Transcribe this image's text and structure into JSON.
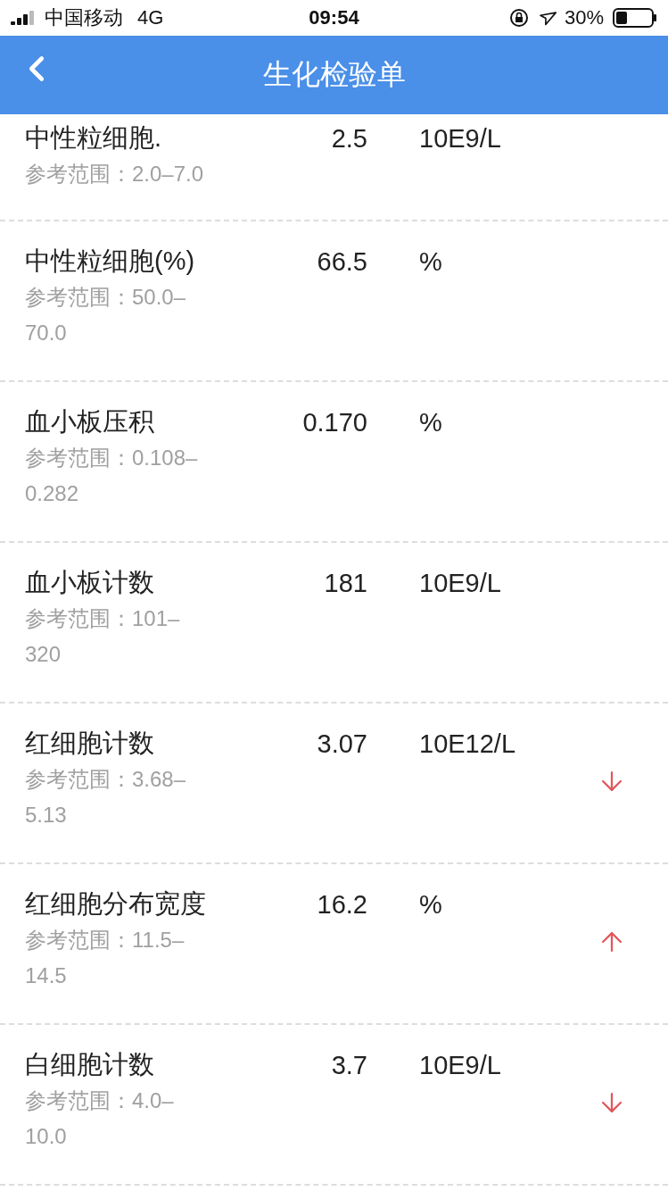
{
  "status_bar": {
    "carrier": "中国移动",
    "network": "4G",
    "time": "09:54",
    "battery": "30%"
  },
  "nav": {
    "title": "生化检验单"
  },
  "rows": [
    {
      "name": "中性粒细胞.",
      "value": "2.5",
      "unit": "10E9/L",
      "reference": "参考范围：2.0–7.0",
      "low": false,
      "high": false
    },
    {
      "name": "中性粒细胞(%)",
      "value": "66.5",
      "unit": "%",
      "reference": "参考范围：50.0–70.0",
      "low": false,
      "high": false
    },
    {
      "name": "血小板压积",
      "value": "0.170",
      "unit": "%",
      "reference": "参考范围：0.108–0.282",
      "low": false,
      "high": false
    },
    {
      "name": "血小板计数",
      "value": "181",
      "unit": "10E9/L",
      "reference": "参考范围：101–320",
      "low": false,
      "high": false
    },
    {
      "name": "红细胞计数",
      "value": "3.07",
      "unit": "10E12/L",
      "reference": "参考范围：3.68–5.13",
      "low": true,
      "high": false
    },
    {
      "name": "红细胞分布宽度",
      "value": "16.2",
      "unit": "%",
      "reference": "参考范围：11.5–14.5",
      "low": false,
      "high": true
    },
    {
      "name": "白细胞计数",
      "value": "3.7",
      "unit": "10E9/L",
      "reference": "参考范围：4.0–10.0",
      "low": true,
      "high": false
    }
  ]
}
